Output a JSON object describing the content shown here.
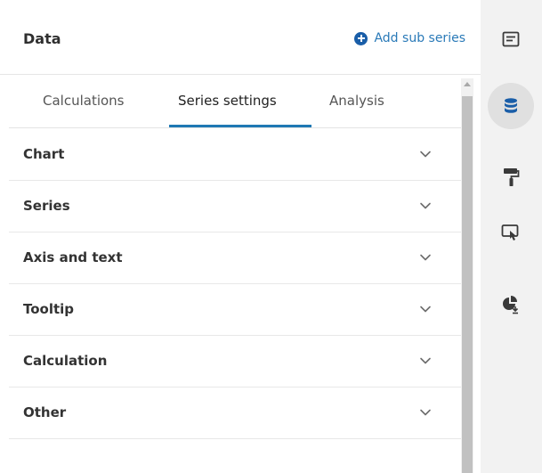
{
  "header": {
    "title": "Data",
    "add_sub_series_label": "Add sub series"
  },
  "tabs": [
    {
      "label": "Calculations",
      "active": false
    },
    {
      "label": "Series settings",
      "active": true
    },
    {
      "label": "Analysis",
      "active": false
    }
  ],
  "sections": [
    {
      "label": "Chart"
    },
    {
      "label": "Series"
    },
    {
      "label": "Axis and text"
    },
    {
      "label": "Tooltip"
    },
    {
      "label": "Calculation"
    },
    {
      "label": "Other"
    }
  ],
  "rail": {
    "icons": [
      "document-icon",
      "database-icon",
      "paint-roller-icon",
      "pointer-screen-icon",
      "pie-chart-download-icon"
    ],
    "active_index": 1
  },
  "colors": {
    "accent": "#1f78b4",
    "link": "#2a7ab8",
    "active_icon": "#1a5ea8",
    "rail_bg": "#f2f2f2"
  }
}
